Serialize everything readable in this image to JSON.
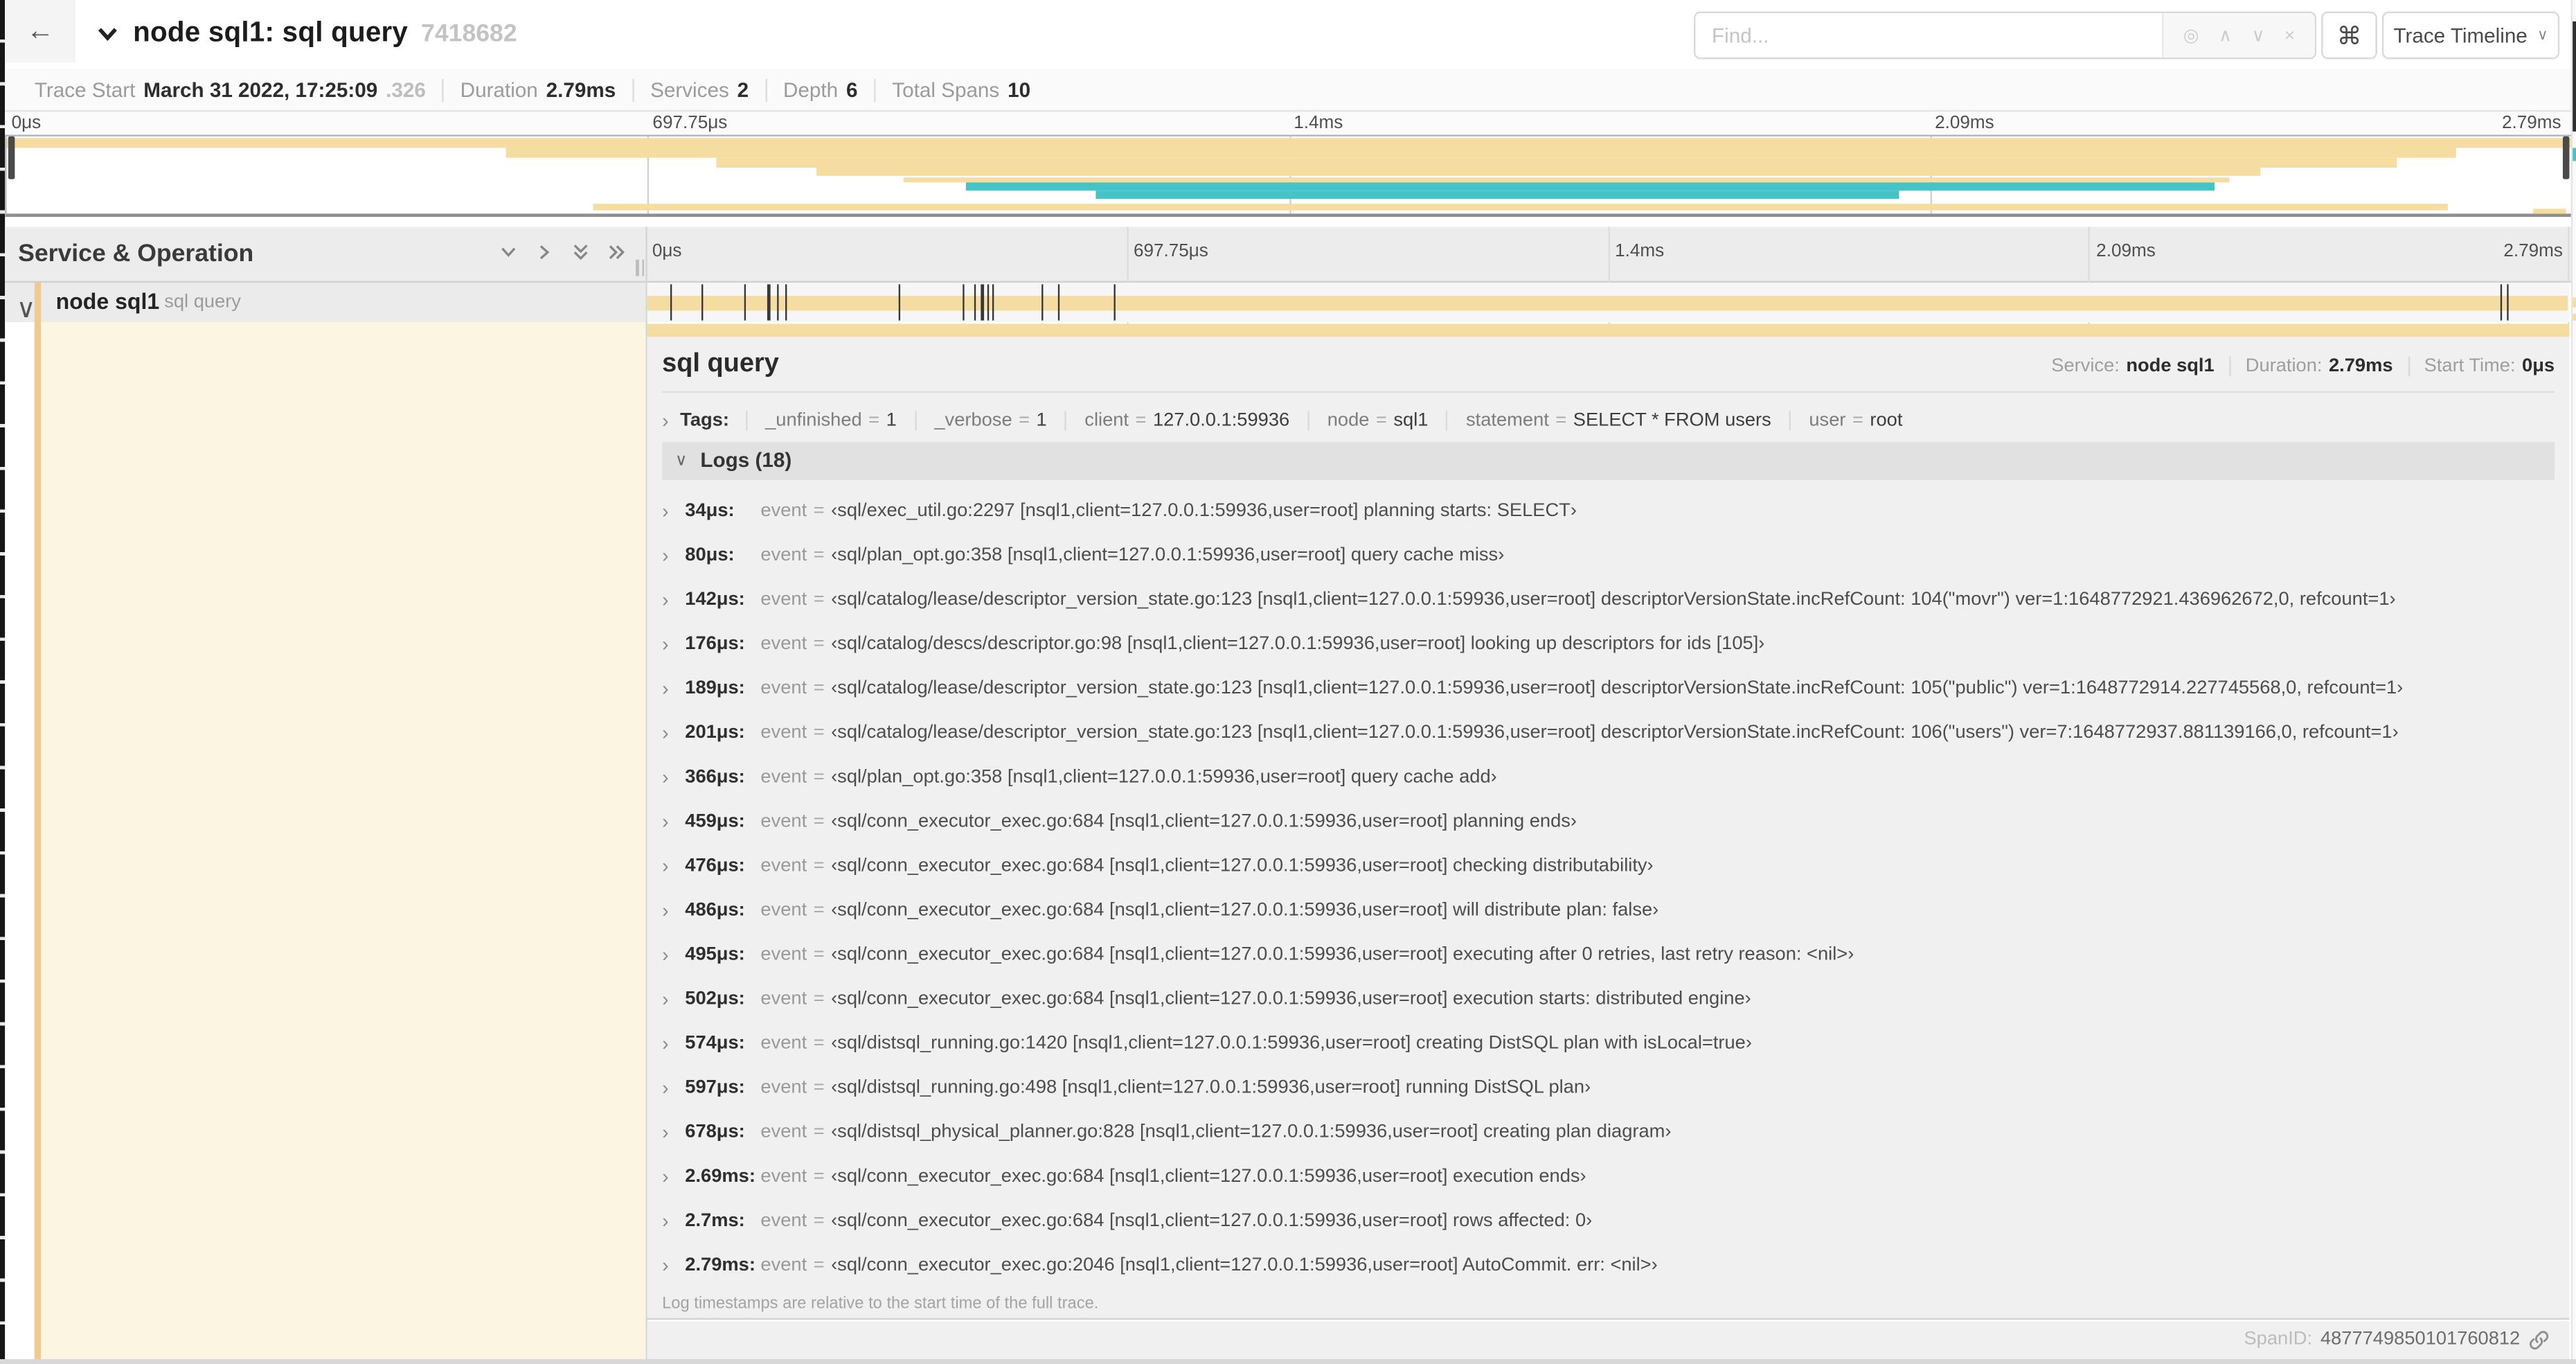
{
  "header": {
    "back_icon": "←",
    "title": "node sql1: sql query",
    "trace_id": "7418682",
    "find_placeholder": "Find...",
    "find_icons": [
      "◎",
      "∧",
      "∨",
      "×"
    ],
    "shortcut_key": "⌘",
    "view_selector": "Trace Timeline",
    "view_caret": "∨"
  },
  "summary": {
    "items": [
      {
        "label": "Trace Start",
        "value": "March 31 2022, 17:25:09",
        "suffix": ".326"
      },
      {
        "label": "Duration",
        "value": "2.79ms"
      },
      {
        "label": "Services",
        "value": "2"
      },
      {
        "label": "Depth",
        "value": "6"
      },
      {
        "label": "Total Spans",
        "value": "10"
      }
    ]
  },
  "colors": {
    "tan": "#F5DCA1",
    "teal": "#45C4C8",
    "stripe": "#EFCB90",
    "cream": "#FCF5E2"
  },
  "minimap": {
    "ticks": [
      {
        "pct": 0,
        "label": "0μs"
      },
      {
        "pct": 25,
        "label": "697.75μs"
      },
      {
        "pct": 50,
        "label": "1.4ms"
      },
      {
        "pct": 75,
        "label": "2.09ms"
      },
      {
        "pct": 100,
        "label": "2.79ms"
      }
    ],
    "strips": [
      {
        "t": 1,
        "h": 5.8,
        "l": 0,
        "w": 100,
        "c": "tan"
      },
      {
        "t": 7,
        "h": 5.8,
        "l": 19.5,
        "w": 76,
        "c": "tan"
      },
      {
        "t": 13,
        "h": 5.6,
        "l": 27.7,
        "w": 65.5,
        "c": "tan"
      },
      {
        "t": 18.8,
        "h": 5.6,
        "l": 31.6,
        "w": 56.3,
        "c": "tan"
      },
      {
        "t": 24.5,
        "h": 3.2,
        "l": 35,
        "w": 51.7,
        "c": "tan"
      },
      {
        "t": 28,
        "h": 4.8,
        "l": 37.4,
        "w": 48.7,
        "c": "teal"
      },
      {
        "t": 32.8,
        "h": 4.8,
        "l": 42.5,
        "w": 31.3,
        "c": "teal"
      },
      {
        "t": 41,
        "h": 4,
        "l": 22.9,
        "w": 72.3,
        "c": "tan"
      },
      {
        "t": 43.5,
        "h": 3.5,
        "l": 98.5,
        "w": 1.3,
        "c": "tan"
      }
    ]
  },
  "timeline": {
    "left_header": "Service & Operation",
    "ticks": [
      {
        "pct": 0,
        "label": "0μs"
      },
      {
        "pct": 25,
        "label": "697.75μs"
      },
      {
        "pct": 50,
        "label": "1.4ms"
      },
      {
        "pct": 75,
        "label": "2.09ms"
      },
      {
        "pct": 100,
        "label": "2.79ms"
      }
    ],
    "row": {
      "chevron": "∨",
      "service": "node sql1",
      "operation": "sql query",
      "log_mark_fractions": [
        0.0122,
        0.0287,
        0.0509,
        0.0631,
        0.0677,
        0.072,
        0.1312,
        0.1645,
        0.1706,
        0.1742,
        0.1774,
        0.1799,
        0.2057,
        0.214,
        0.243,
        0.9642,
        0.9677
      ]
    }
  },
  "detail": {
    "operation": "sql query",
    "meta": [
      {
        "label": "Service:",
        "value": "node sql1"
      },
      {
        "label": "Duration:",
        "value": "2.79ms"
      },
      {
        "label": "Start Time:",
        "value": "0μs"
      }
    ],
    "tags_chevron": "›",
    "tags_label": "Tags:",
    "tags": [
      {
        "key": "_unfinished",
        "value": "1"
      },
      {
        "key": "_verbose",
        "value": "1"
      },
      {
        "key": "client",
        "value": "127.0.0.1:59936"
      },
      {
        "key": "node",
        "value": "sql1"
      },
      {
        "key": "statement",
        "value": "SELECT * FROM users"
      },
      {
        "key": "user",
        "value": "root"
      }
    ],
    "logs_chevron": "∨",
    "logs_label": "Logs (18)",
    "log_field": "event",
    "log_eq": "=",
    "logs": [
      {
        "time": "34μs:",
        "value": "‹sql/exec_util.go:2297 [nsql1,client=127.0.0.1:59936,user=root] planning starts: SELECT›"
      },
      {
        "time": "80μs:",
        "value": "‹sql/plan_opt.go:358 [nsql1,client=127.0.0.1:59936,user=root] query cache miss›"
      },
      {
        "time": "142μs:",
        "value": "‹sql/catalog/lease/descriptor_version_state.go:123 [nsql1,client=127.0.0.1:59936,user=root] descriptorVersionState.incRefCount: 104(\"movr\") ver=1:1648772921.436962672,0, refcount=1›"
      },
      {
        "time": "176μs:",
        "value": "‹sql/catalog/descs/descriptor.go:98 [nsql1,client=127.0.0.1:59936,user=root] looking up descriptors for ids [105]›"
      },
      {
        "time": "189μs:",
        "value": "‹sql/catalog/lease/descriptor_version_state.go:123 [nsql1,client=127.0.0.1:59936,user=root] descriptorVersionState.incRefCount: 105(\"public\") ver=1:1648772914.227745568,0, refcount=1›"
      },
      {
        "time": "201μs:",
        "value": "‹sql/catalog/lease/descriptor_version_state.go:123 [nsql1,client=127.0.0.1:59936,user=root] descriptorVersionState.incRefCount: 106(\"users\") ver=7:1648772937.881139166,0, refcount=1›"
      },
      {
        "time": "366μs:",
        "value": "‹sql/plan_opt.go:358 [nsql1,client=127.0.0.1:59936,user=root] query cache add›"
      },
      {
        "time": "459μs:",
        "value": "‹sql/conn_executor_exec.go:684 [nsql1,client=127.0.0.1:59936,user=root] planning ends›"
      },
      {
        "time": "476μs:",
        "value": "‹sql/conn_executor_exec.go:684 [nsql1,client=127.0.0.1:59936,user=root] checking distributability›"
      },
      {
        "time": "486μs:",
        "value": "‹sql/conn_executor_exec.go:684 [nsql1,client=127.0.0.1:59936,user=root] will distribute plan: false›"
      },
      {
        "time": "495μs:",
        "value": "‹sql/conn_executor_exec.go:684 [nsql1,client=127.0.0.1:59936,user=root] executing after 0 retries, last retry reason: <nil>›"
      },
      {
        "time": "502μs:",
        "value": "‹sql/conn_executor_exec.go:684 [nsql1,client=127.0.0.1:59936,user=root] execution starts: distributed engine›"
      },
      {
        "time": "574μs:",
        "value": "‹sql/distsql_running.go:1420 [nsql1,client=127.0.0.1:59936,user=root] creating DistSQL plan with isLocal=true›"
      },
      {
        "time": "597μs:",
        "value": "‹sql/distsql_running.go:498 [nsql1,client=127.0.0.1:59936,user=root] running DistSQL plan›"
      },
      {
        "time": "678μs:",
        "value": "‹sql/distsql_physical_planner.go:828 [nsql1,client=127.0.0.1:59936,user=root] creating plan diagram›"
      },
      {
        "time": "2.69ms:",
        "value": "‹sql/conn_executor_exec.go:684 [nsql1,client=127.0.0.1:59936,user=root] execution ends›"
      },
      {
        "time": "2.7ms:",
        "value": "‹sql/conn_executor_exec.go:684 [nsql1,client=127.0.0.1:59936,user=root] rows affected: 0›"
      },
      {
        "time": "2.79ms:",
        "value": "‹sql/conn_executor_exec.go:2046 [nsql1,client=127.0.0.1:59936,user=root] AutoCommit. err: <nil>›"
      }
    ],
    "footnote": "Log timestamps are relative to the start time of the full trace.",
    "spanid_label": "SpanID:",
    "spanid": "4877749850101760812"
  }
}
